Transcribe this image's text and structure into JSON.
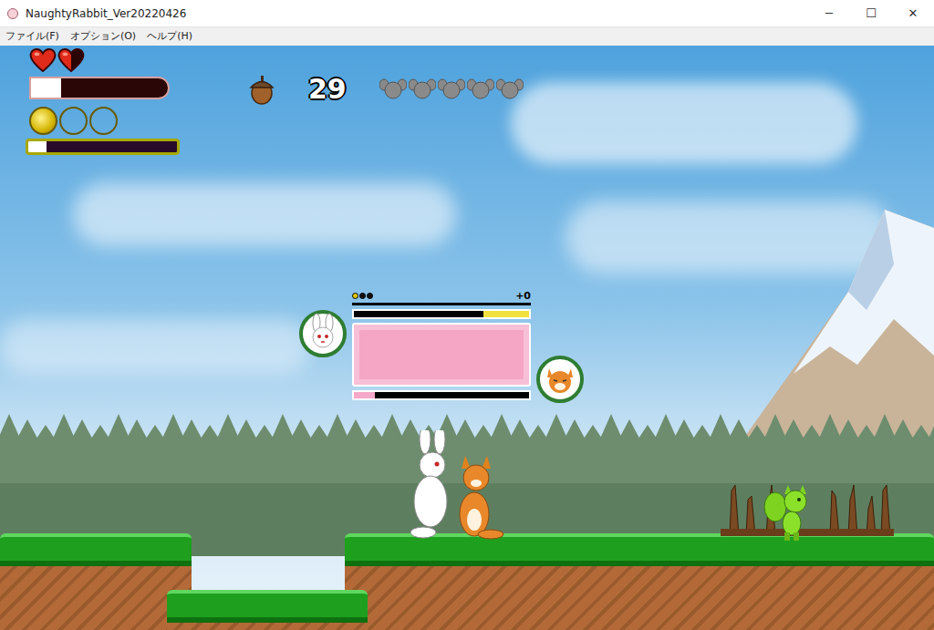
{
  "window": {
    "title": "NaughtyRabbit_Ver20220426",
    "controls": [
      "─",
      "☐",
      "✕"
    ]
  },
  "menu": [
    "ファイル(F)",
    "オプション(O)",
    "ヘルプ(H)"
  ],
  "hud": {
    "hearts": [
      {
        "level": 1
      },
      {
        "level": 0.5
      }
    ],
    "health": {
      "level": 0.22
    },
    "coins": [
      {
        "filled": true
      },
      {
        "filled": false
      },
      {
        "filled": false
      }
    ],
    "charge": {
      "level": 0.12
    },
    "acorns": "29",
    "lives": [
      {
        "filled": false
      },
      {
        "filled": false
      },
      {
        "filled": false
      },
      {
        "filled": false
      },
      {
        "filled": false
      }
    ]
  },
  "encounter": {
    "pips": [
      {
        "filled": true
      },
      {
        "filled": false
      },
      {
        "filled": false
      }
    ],
    "score": "+0",
    "stamina": {
      "level": 0.26
    },
    "meter": {
      "level": 0.12
    }
  }
}
